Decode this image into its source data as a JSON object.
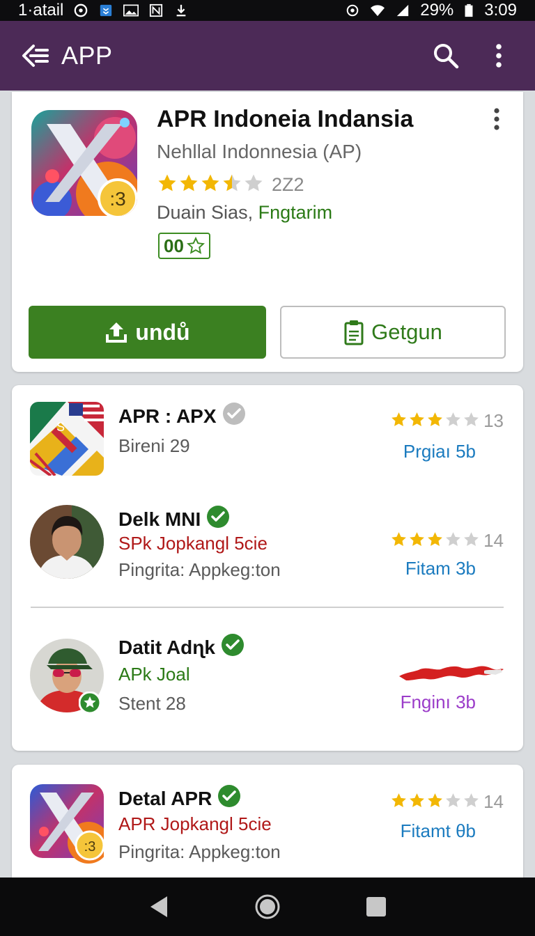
{
  "status_bar": {
    "carrier": "1·atail",
    "battery": "29%",
    "time": "3:09"
  },
  "app_bar": {
    "title": "APP"
  },
  "hero": {
    "title": "APR Indoneia Indansia",
    "subtitle": "Nehllal Indonnesia (AP)",
    "rating": 3.5,
    "rating_count": "2Z2",
    "developer": "Duain Sias,",
    "category": "Fngtarim",
    "badge": "00",
    "install_label": "undů",
    "share_label": "Getgun"
  },
  "list": [
    {
      "name": "APR : APX",
      "verified_color": "#bdbdbd",
      "line2": "Bireni 29",
      "line2_color": "#5a5a5a",
      "line3": "",
      "rating": 3,
      "rating_count": "13",
      "side": "Prgiaı 5b",
      "side_color": "#1b7bbf"
    },
    {
      "name": "Delk MNI",
      "verified_color": "#2e8b2e",
      "line2": "SPk Jopkangl 5cie",
      "line2_color": "#b01818",
      "line3": "Pingrita: Appkeg:ton",
      "rating": 3,
      "rating_count": "14",
      "side": "Fitam 3b",
      "side_color": "#1b7bbf"
    },
    {
      "name": "Datit Adɳk",
      "verified_color": "#2e8b2e",
      "line2": "APk Joal",
      "line2_color": "#2b7a16",
      "line3": "Stent 28",
      "rating": null,
      "rating_count": "",
      "side": "Fnginı 3b",
      "side_color": "#9b3cc9"
    }
  ],
  "last_item": {
    "name": "Detal APR",
    "verified_color": "#2e8b2e",
    "line2": "APR Jopkangl 5cie",
    "line2_color": "#b01818",
    "line3": "Pingrita: Appkeg:ton",
    "rating": 3,
    "rating_count": "14",
    "side": "Fitamt θb",
    "side_color": "#1b7bbf"
  },
  "colors": {
    "app_bar": "#4c2a57",
    "install": "#3b8021",
    "star": "#f2b705"
  },
  "icons": {
    "back": "back-arrow-icon",
    "search": "search-icon",
    "more": "more-vert-icon",
    "install": "upload-icon",
    "share": "clipboard-icon",
    "verified": "check-circle-icon",
    "nav": [
      "back-triangle-icon",
      "home-circle-icon",
      "recents-square-icon"
    ]
  }
}
